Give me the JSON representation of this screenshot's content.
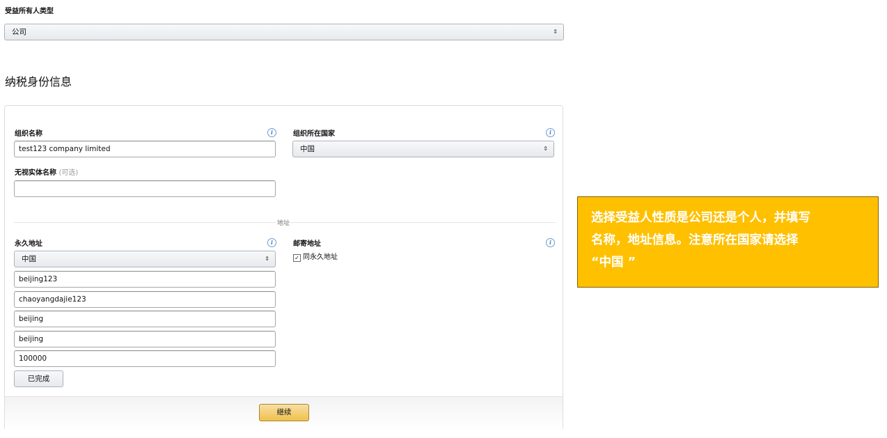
{
  "beneficiary": {
    "label": "受益所有人类型",
    "value": "公司"
  },
  "section_title": "纳税身份信息",
  "org": {
    "name_label": "组织名称",
    "name_value": "test123 company limited",
    "country_label": "组织所在国家",
    "country_value": "中国",
    "disregarded_label": "无视实体名称",
    "optional_text": "(可选)",
    "disregarded_value": ""
  },
  "address": {
    "divider_label": "地址",
    "permanent_label": "永久地址",
    "country_value": "中国",
    "line1": "beijing123",
    "line2": "chaoyangdajie123",
    "city": "beijing",
    "state": "beijing",
    "postal": "100000",
    "done_button": "已完成",
    "mailing_label": "邮寄地址",
    "same_as_checkbox": "同永久地址",
    "checkbox_checked": true
  },
  "continue_button": "继续",
  "info_icon_glyph": "i",
  "note": {
    "line1": "选择受益人性质是公司还是个人，并填写",
    "line2": "名称，地址信息。注意所在国家请选择",
    "line3": "“中国 ”",
    "background": "#ffc000"
  }
}
